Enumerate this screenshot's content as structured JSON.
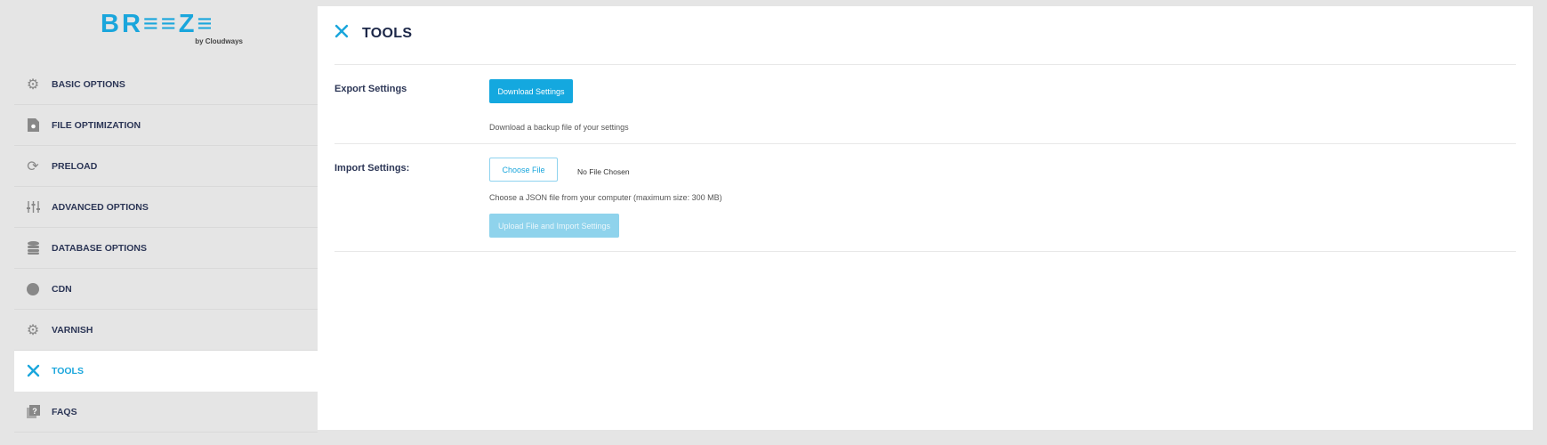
{
  "logo": {
    "brand": "BR≡≡Z≡",
    "sub": "by Cloudways"
  },
  "sidebar": {
    "items": [
      {
        "label": "BASIC OPTIONS",
        "icon": "gears-icon"
      },
      {
        "label": "FILE OPTIMIZATION",
        "icon": "file-gear-icon"
      },
      {
        "label": "PRELOAD",
        "icon": "refresh-icon"
      },
      {
        "label": "ADVANCED OPTIONS",
        "icon": "sliders-icon"
      },
      {
        "label": "DATABASE OPTIONS",
        "icon": "database-icon"
      },
      {
        "label": "CDN",
        "icon": "globe-icon"
      },
      {
        "label": "VARNISH",
        "icon": "gears-icon"
      },
      {
        "label": "TOOLS",
        "icon": "tools-icon",
        "active": true
      },
      {
        "label": "FAQS",
        "icon": "question-icon"
      }
    ]
  },
  "main": {
    "title": "TOOLS",
    "export": {
      "label": "Export Settings",
      "button": "Download Settings",
      "help": "Download a backup file of your settings"
    },
    "import": {
      "label": "Import Settings:",
      "choose_button": "Choose File",
      "file_status": "No File Chosen",
      "help": "Choose a JSON file from your computer (maximum size: 300 MB)",
      "upload_button": "Upload File and Import Settings"
    }
  },
  "colors": {
    "accent": "#14a8df",
    "text": "#2c3656"
  }
}
